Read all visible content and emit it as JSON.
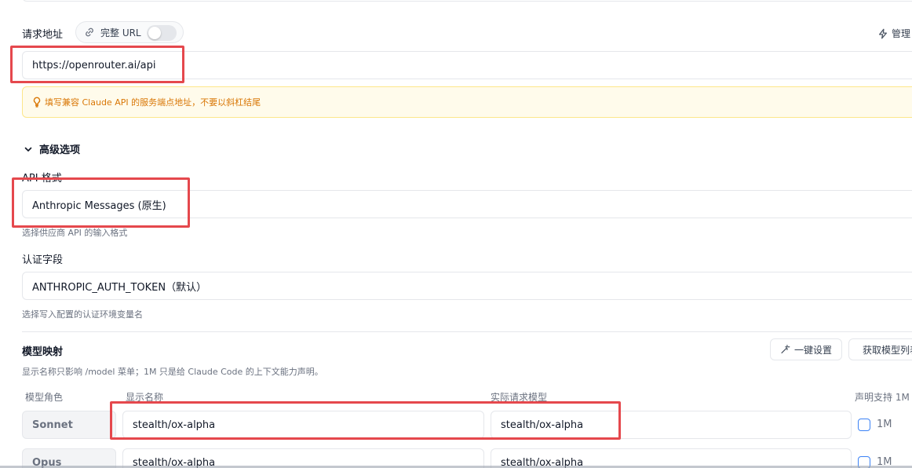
{
  "request_url": {
    "label": "请求地址",
    "full_url_toggle_label": "完整 URL",
    "full_url_enabled": false,
    "manage_label": "管理",
    "value": "https://openrouter.ai/api",
    "warning": "填写兼容 Claude API 的服务端点地址，不要以斜杠结尾"
  },
  "advanced": {
    "title": "高级选项",
    "api_format": {
      "label": "API 格式",
      "value": "Anthropic Messages (原生)",
      "hint": "选择供应商 API 的输入格式"
    },
    "auth_field": {
      "label": "认证字段",
      "value": "ANTHROPIC_AUTH_TOKEN（默认）",
      "hint": "选择写入配置的认证环境变量名"
    }
  },
  "model_mapping": {
    "title": "模型映射",
    "hint": "显示名称只影响 /model 菜单；1M 只是给 Claude Code 的上下文能力声明。",
    "one_click_label": "一键设置",
    "fetch_label": "获取模型列表",
    "columns": [
      "模型角色",
      "显示名称",
      "实际请求模型",
      "声明支持 1M"
    ],
    "rows": [
      {
        "role": "Sonnet",
        "display_name": "stealth/ox-alpha",
        "request_model": "stealth/ox-alpha",
        "checkbox_label": "1M",
        "checked": false
      },
      {
        "role": "Opus",
        "display_name": "stealth/ox-alpha",
        "request_model": "stealth/ox-alpha",
        "checkbox_label": "1M",
        "checked": false
      }
    ]
  },
  "colors": {
    "annotation": "#e5484d",
    "warning_text": "#d97706",
    "warning_bg": "#fffbeb",
    "checkbox": "#3b82f6"
  }
}
